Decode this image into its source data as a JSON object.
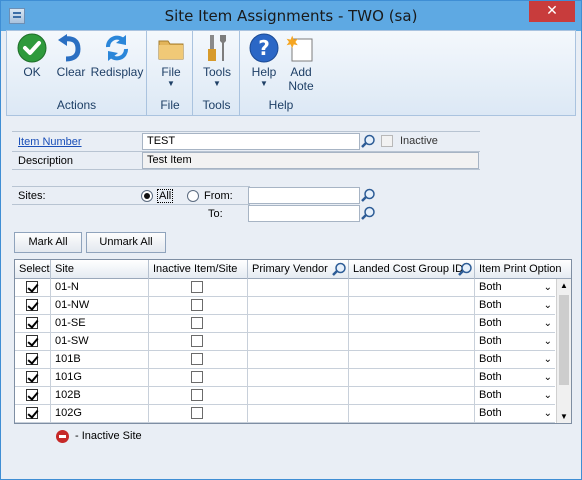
{
  "window": {
    "title": "Site Item Assignments  -  TWO (sa)",
    "close_label": "✕"
  },
  "ribbon": {
    "groups": [
      {
        "label": "Actions",
        "buttons": [
          {
            "label": "OK",
            "icon": "ok-check-icon"
          },
          {
            "label": "Clear",
            "icon": "undo-arrow-icon"
          },
          {
            "label": "Redisplay",
            "icon": "refresh-icon"
          }
        ]
      },
      {
        "label": "File",
        "buttons": [
          {
            "label": "File",
            "icon": "folder-icon",
            "arrow": "▼"
          }
        ]
      },
      {
        "label": "Tools",
        "buttons": [
          {
            "label": "Tools",
            "icon": "tools-icon",
            "arrow": "▼"
          }
        ]
      },
      {
        "label": "Help",
        "buttons": [
          {
            "label": "Help",
            "icon": "help-icon",
            "arrow": "▼"
          },
          {
            "label": "Add",
            "label2": "Note",
            "icon": "add-note-icon"
          }
        ]
      }
    ]
  },
  "form": {
    "item_number_label": "Item Number",
    "item_number_value": "TEST",
    "inactive_label": "Inactive",
    "inactive_checked": false,
    "description_label": "Description",
    "description_value": "Test Item",
    "sites_label": "Sites:",
    "all_label": "All",
    "from_label": "From:",
    "to_label": "To:",
    "from_value": "",
    "to_value": "",
    "sites_selection": "All"
  },
  "buttons": {
    "mark_all": "Mark All",
    "unmark_all": "Unmark All"
  },
  "grid": {
    "columns": [
      "Select",
      "Site",
      "Inactive Item/Site",
      "Primary Vendor",
      "Landed Cost Group ID",
      "Item Print Option"
    ],
    "rows": [
      {
        "select": true,
        "site": "01-N",
        "inactive": false,
        "vendor": "",
        "landed": "",
        "print": "Both"
      },
      {
        "select": true,
        "site": "01-NW",
        "inactive": false,
        "vendor": "",
        "landed": "",
        "print": "Both"
      },
      {
        "select": true,
        "site": "01-SE",
        "inactive": false,
        "vendor": "",
        "landed": "",
        "print": "Both"
      },
      {
        "select": true,
        "site": "01-SW",
        "inactive": false,
        "vendor": "",
        "landed": "",
        "print": "Both"
      },
      {
        "select": true,
        "site": "101B",
        "inactive": false,
        "vendor": "",
        "landed": "",
        "print": "Both"
      },
      {
        "select": true,
        "site": "101G",
        "inactive": false,
        "vendor": "",
        "landed": "",
        "print": "Both"
      },
      {
        "select": true,
        "site": "102B",
        "inactive": false,
        "vendor": "",
        "landed": "",
        "print": "Both"
      },
      {
        "select": true,
        "site": "102G",
        "inactive": false,
        "vendor": "",
        "landed": "",
        "print": "Both"
      }
    ]
  },
  "legend": {
    "text": "- Inactive Site"
  }
}
